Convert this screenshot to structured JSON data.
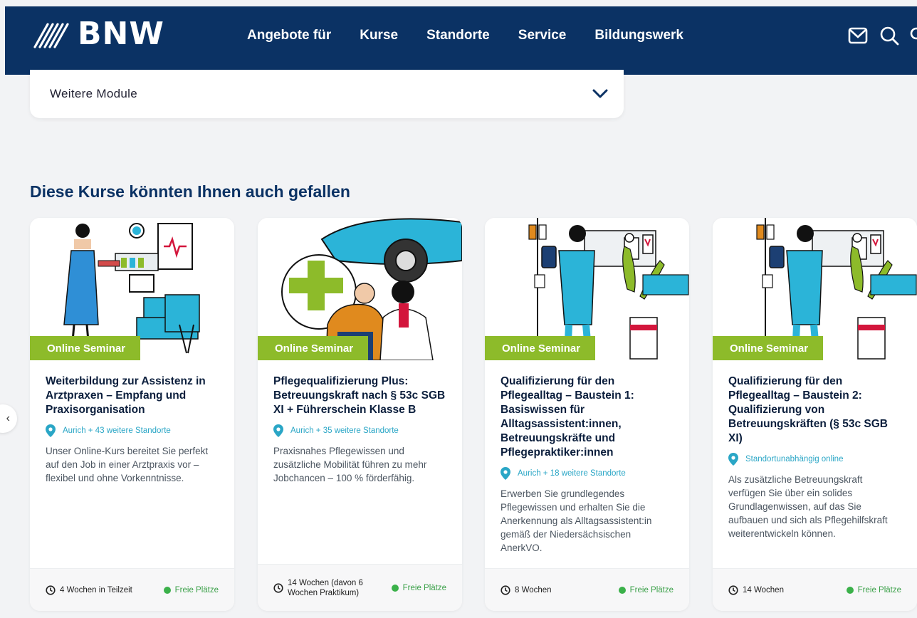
{
  "header": {
    "logo_text": "BNW",
    "nav": [
      "Angebote für",
      "Kurse",
      "Standorte",
      "Service",
      "Bildungswerk"
    ],
    "icons": [
      "mail-icon",
      "search-icon"
    ]
  },
  "accordion": {
    "label": "Weitere Module"
  },
  "section_title": "Diese Kurse könnten Ihnen auch gefallen",
  "cards": [
    {
      "badge": "Online Seminar",
      "title": "Weiterbildung zur Assistenz in Arztpraxen – Empfang und Praxisorganisation",
      "location": "Aurich + 43 weitere Standorte",
      "description": "Unser Online-Kurs bereitet Sie perfekt auf den Job in einer Arztpraxis vor – flexibel und ohne Vorkenntnisse.",
      "duration": "4 Wochen in Teilzeit",
      "availability": "Freie Plätze"
    },
    {
      "badge": "Online Seminar",
      "title": "Pflegequalifizierung Plus: Betreuungskraft nach § 53c SGB XI + Führerschein Klasse B",
      "location": "Aurich + 35 weitere Standorte",
      "description": "Praxisnahes Pflegewissen und zusätzliche Mobilität führen zu mehr Jobchancen – 100 % förderfähig.",
      "duration": "14 Wochen (davon 6 Wochen Praktikum)",
      "availability": "Freie Plätze"
    },
    {
      "badge": "Online Seminar",
      "title": "Qualifizierung für den Pflegealltag – Baustein 1: Basiswissen für Alltagsassistent:innen, Betreuungskräfte und Pflegepraktiker:innen",
      "location": "Aurich + 18 weitere Standorte",
      "description": "Erwerben Sie grundlegendes Pflegewissen und erhalten Sie die Anerkennung als Alltagsassistent:in gemäß der Niedersächsischen AnerkVO.",
      "duration": "8 Wochen",
      "availability": "Freie Plätze"
    },
    {
      "badge": "Online Seminar",
      "title": "Qualifizierung für den Pflegealltag – Baustein 2: Qualifizierung von Betreuungskräften (§ 53c SGB XI)",
      "location": "Standortunabhängig online",
      "description": "Als zusätzliche Betreuungskraft verfügen Sie über ein solides Grundlagenwissen, auf das Sie aufbauen und sich als Pflegehilfskraft weiterentwickeln können.",
      "duration": "14 Wochen",
      "availability": "Freie Plätze"
    }
  ],
  "colors": {
    "header": "#0b3264",
    "badge": "#8dbb2a",
    "accent": "#2aa6c6",
    "free": "#3bb14a"
  }
}
